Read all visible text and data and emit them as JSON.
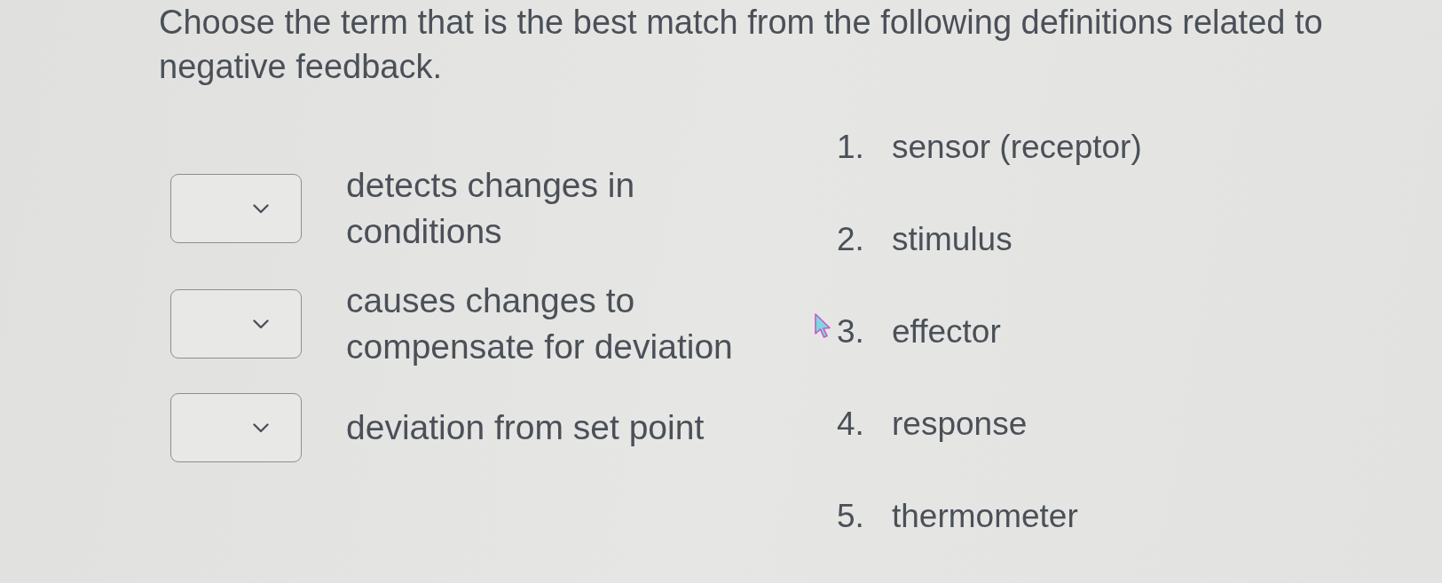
{
  "question": "Choose the term that is the best match from the following definitions related to negative feedback.",
  "matches": [
    {
      "definition": "detects changes in conditions"
    },
    {
      "definition": "causes changes to compensate for deviation"
    },
    {
      "definition": "deviation from set point"
    }
  ],
  "options": [
    {
      "number": "1.",
      "label": "sensor (receptor)"
    },
    {
      "number": "2.",
      "label": "stimulus"
    },
    {
      "number": "3.",
      "label": "effector"
    },
    {
      "number": "4.",
      "label": "response"
    },
    {
      "number": "5.",
      "label": "thermometer"
    }
  ]
}
